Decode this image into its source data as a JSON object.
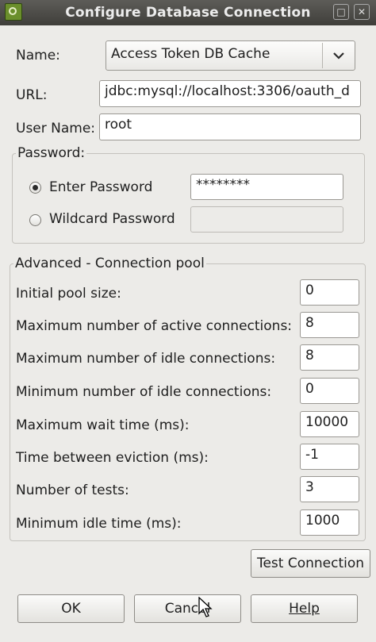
{
  "window": {
    "title": "Configure Database Connection",
    "icons": {
      "app": "app-icon",
      "maximize": "maximize-icon",
      "close": "close-icon"
    }
  },
  "form": {
    "name_label": "Name:",
    "name_value": "Access Token DB Cache",
    "url_label": "URL:",
    "url_value": "jdbc:mysql://localhost:3306/oauth_d",
    "user_label": "User Name:",
    "user_value": "root"
  },
  "password": {
    "legend": "Password:",
    "enter_label": "Enter Password",
    "enter_value": "********",
    "wildcard_label": "Wildcard Password",
    "wildcard_value": "",
    "selected": "enter"
  },
  "pool": {
    "legend": "Advanced - Connection pool",
    "rows": [
      {
        "label": "Initial pool size:",
        "value": "0"
      },
      {
        "label": "Maximum number of active connections:",
        "value": "8"
      },
      {
        "label": "Maximum number of idle connections:",
        "value": "8"
      },
      {
        "label": "Minimum number of idle connections:",
        "value": "0"
      },
      {
        "label": "Maximum wait time (ms):",
        "value": "10000"
      },
      {
        "label": "Time between eviction (ms):",
        "value": "-1"
      },
      {
        "label": "Number of tests:",
        "value": "3"
      },
      {
        "label": "Minimum idle time (ms):",
        "value": "1000"
      }
    ]
  },
  "buttons": {
    "test_connection": "Test Connection",
    "ok": "OK",
    "cancel": "Cancel",
    "help": "Help"
  }
}
